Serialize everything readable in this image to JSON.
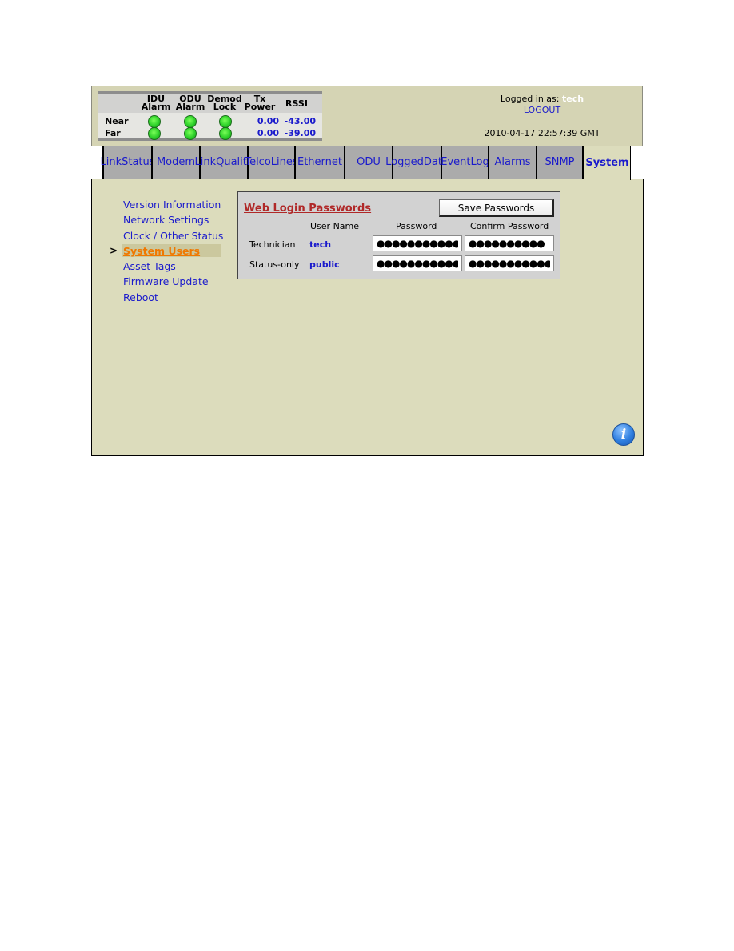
{
  "status": {
    "columns": [
      {
        "line1": "IDU",
        "line2": "Alarm"
      },
      {
        "line1": "ODU",
        "line2": "Alarm"
      },
      {
        "line1": "Demod",
        "line2": "Lock"
      },
      {
        "line1": "Tx",
        "line2": "Power"
      },
      {
        "line1": "",
        "line2": "RSSI"
      }
    ],
    "rows": [
      {
        "label": "Near",
        "idu_alarm": "green",
        "odu_alarm": "green",
        "demod_lock": "green",
        "tx_power": "0.00",
        "rssi": "-43.00"
      },
      {
        "label": "Far",
        "idu_alarm": "green",
        "odu_alarm": "green",
        "demod_lock": "green",
        "tx_power": "0.00",
        "rssi": "-39.00"
      }
    ]
  },
  "login": {
    "prefix": "Logged in as:",
    "user": "tech",
    "logout": "LOGOUT",
    "datetime": "2010-04-17 22:57:39 GMT"
  },
  "tabs": [
    {
      "label": "Link Status",
      "active": false
    },
    {
      "label": "Modem",
      "active": false
    },
    {
      "label": "Link Quality",
      "active": false
    },
    {
      "label": "Telco Lines",
      "active": false
    },
    {
      "label": "Ethernet",
      "active": false
    },
    {
      "label": "ODU",
      "active": false
    },
    {
      "label": "Logged Data",
      "active": false
    },
    {
      "label": "Event Log",
      "active": false
    },
    {
      "label": "Alarms",
      "active": false
    },
    {
      "label": "SNMP",
      "active": false
    },
    {
      "label": "System",
      "active": true
    }
  ],
  "sidebar": {
    "indicator": ">",
    "items": [
      {
        "label": "Version Information",
        "active": false
      },
      {
        "label": "Network Settings",
        "active": false
      },
      {
        "label": "Clock / Other Status",
        "active": false
      },
      {
        "label": "System Users",
        "active": true
      },
      {
        "label": "Asset Tags",
        "active": false
      },
      {
        "label": "Firmware Update",
        "active": false
      },
      {
        "label": "Reboot",
        "active": false
      }
    ]
  },
  "passwords": {
    "title": "Web Login Passwords",
    "save_label": "Save Passwords",
    "headers": {
      "user_name": "User Name",
      "password": "Password",
      "confirm": "Confirm Password"
    },
    "rows": [
      {
        "role": "Technician",
        "user": "tech",
        "password": "●●●●●●●●●●●",
        "confirm": "●●●●●●●●●●"
      },
      {
        "role": "Status-only",
        "user": "public",
        "password": "●●●●●●●●●●●",
        "confirm": "●●●●●●●●●●●"
      }
    ]
  },
  "info_icon": "i",
  "colors": {
    "link": "#1a1acc",
    "active_nav": "#f07800",
    "panel_title": "#b02828",
    "led_ok": "#2ed12a",
    "content_bg": "#dcdcbc"
  }
}
